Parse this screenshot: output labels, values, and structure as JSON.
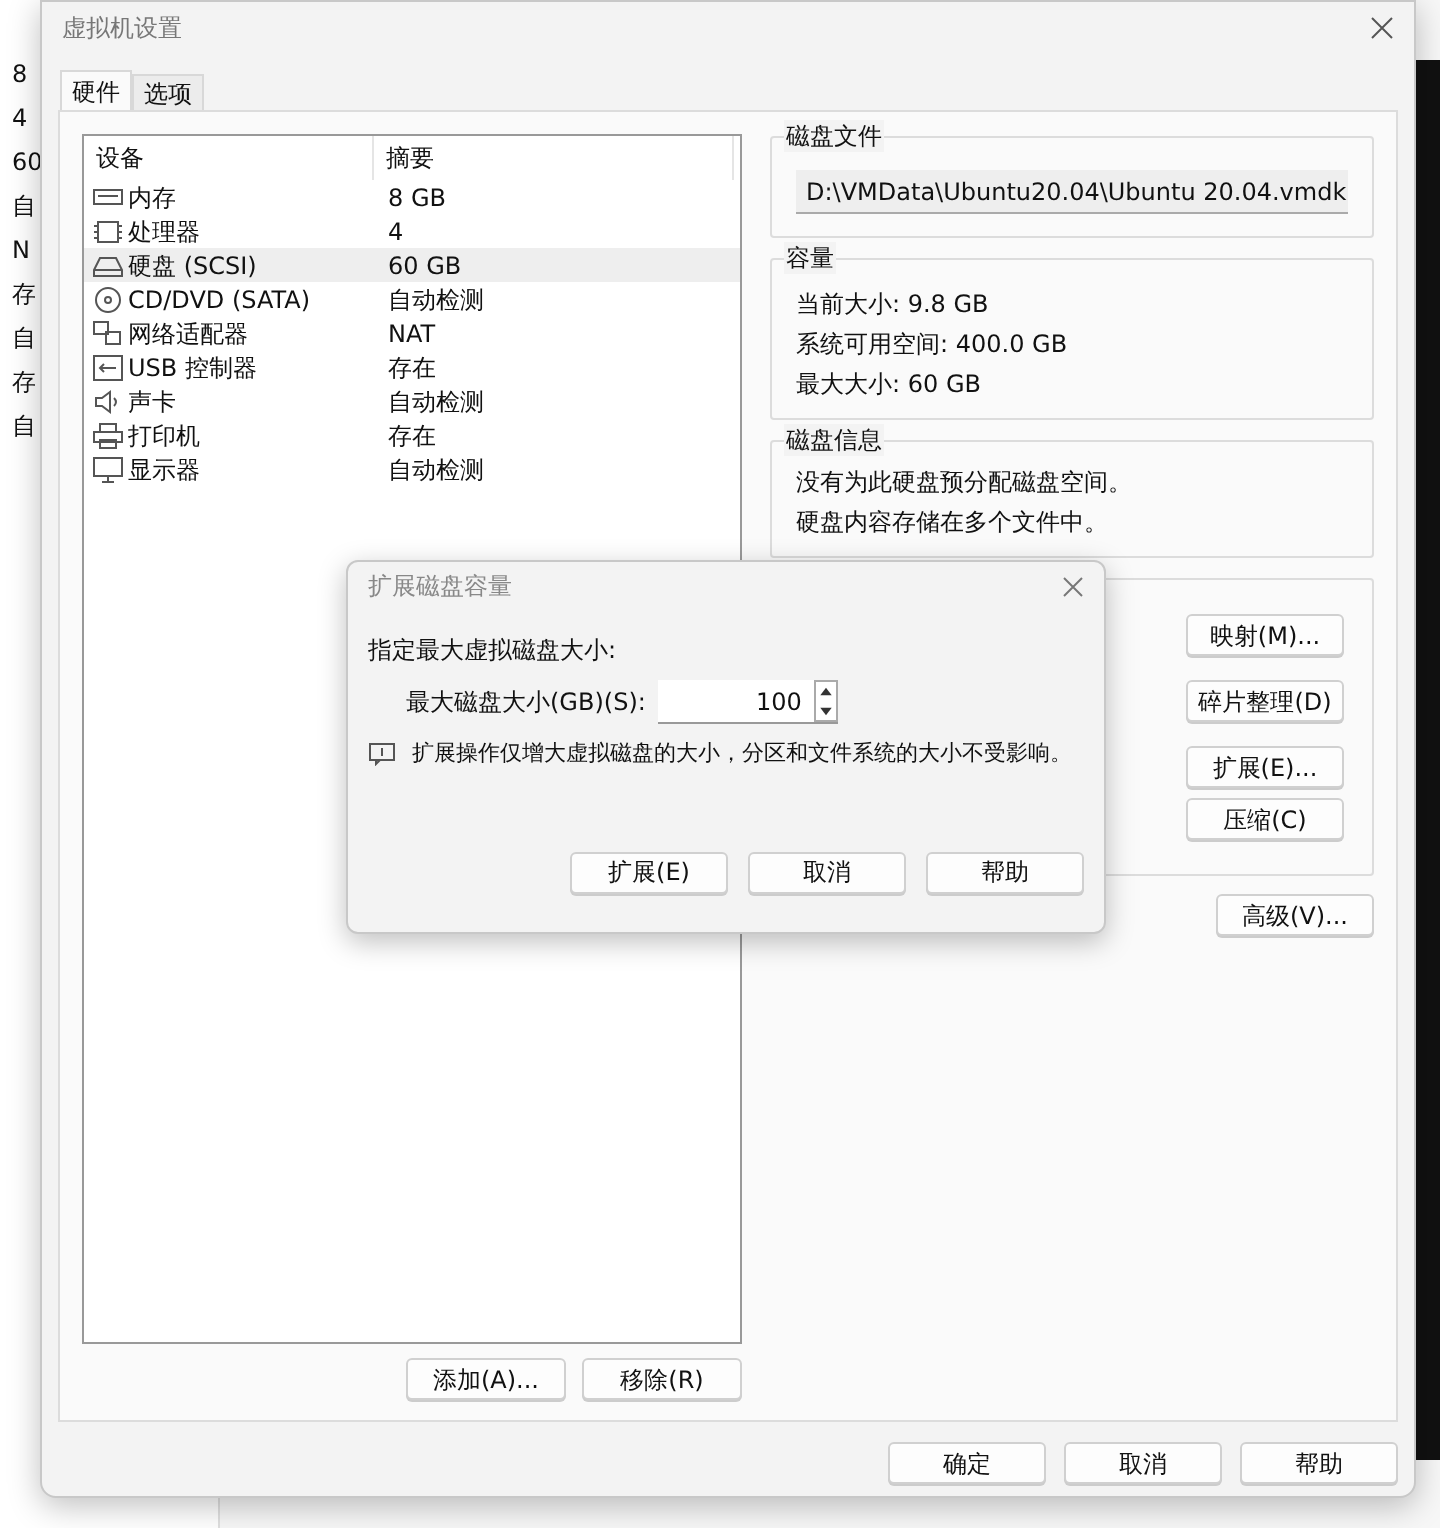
{
  "background_column": [
    "8",
    "4",
    "60",
    "自",
    "N",
    "存",
    "自",
    "存",
    "自"
  ],
  "window": {
    "title": "虚拟机设置"
  },
  "tabs": [
    {
      "label": "硬件",
      "selected": true
    },
    {
      "label": "选项",
      "selected": false
    }
  ],
  "device_table": {
    "columns": [
      "设备",
      "摘要"
    ],
    "rows": [
      {
        "kind": "memory",
        "device": "内存",
        "summary": "8 GB",
        "selected": false
      },
      {
        "kind": "cpu",
        "device": "处理器",
        "summary": "4",
        "selected": false
      },
      {
        "kind": "disk",
        "device": "硬盘 (SCSI)",
        "summary": "60 GB",
        "selected": true
      },
      {
        "kind": "cdrom",
        "device": "CD/DVD (SATA)",
        "summary": "自动检测",
        "selected": false
      },
      {
        "kind": "network",
        "device": "网络适配器",
        "summary": "NAT",
        "selected": false
      },
      {
        "kind": "usb",
        "device": "USB 控制器",
        "summary": "存在",
        "selected": false
      },
      {
        "kind": "sound",
        "device": "声卡",
        "summary": "自动检测",
        "selected": false
      },
      {
        "kind": "printer",
        "device": "打印机",
        "summary": "存在",
        "selected": false
      },
      {
        "kind": "display",
        "device": "显示器",
        "summary": "自动检测",
        "selected": false
      }
    ]
  },
  "list_buttons": [
    "添加(A)...",
    "移除(R)"
  ],
  "disk_file": {
    "title": "磁盘文件",
    "path": "D:\\VMData\\Ubuntu20.04\\Ubuntu 20.04.vmdk"
  },
  "capacity": {
    "title": "容量",
    "lines": [
      "当前大小: 9.8 GB",
      "系统可用空间: 400.0 GB",
      "最大大小: 60 GB"
    ]
  },
  "disk_info": {
    "title": "磁盘信息",
    "lines": [
      "没有为此硬盘预分配磁盘空间。",
      "硬盘内容存储在多个文件中。"
    ]
  },
  "utility_buttons": [
    "映射(M)...",
    "碎片整理(D)",
    "扩展(E)...",
    "压缩(C)"
  ],
  "advanced_button": "高级(V)...",
  "footer_buttons": [
    "确定",
    "取消",
    "帮助"
  ],
  "expand_dialog": {
    "title": "扩展磁盘容量",
    "prompt": "指定最大虚拟磁盘大小:",
    "size_label": "最大磁盘大小(GB)(S):",
    "size_value": "100",
    "note": "扩展操作仅增大虚拟磁盘的大小，分区和文件系统的大小不受影响。",
    "buttons": [
      "扩展(E)",
      "取消",
      "帮助"
    ]
  }
}
